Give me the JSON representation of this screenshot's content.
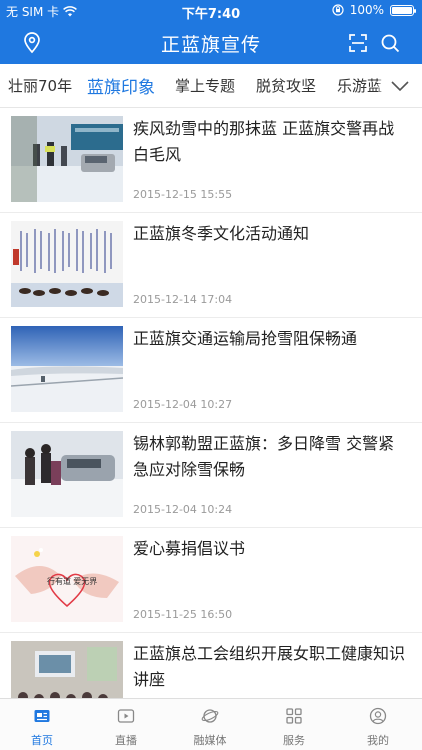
{
  "status_bar": {
    "carrier": "无 SIM 卡",
    "time": "下午7:40",
    "battery": "100%",
    "battery_level": 1.0
  },
  "header": {
    "title": "正蓝旗宣传",
    "left_icon": "location-icon",
    "right_icons": [
      "scan-icon",
      "search-icon"
    ]
  },
  "tabs": {
    "items": [
      "壮丽70年",
      "蓝旗印象",
      "掌上专题",
      "脱贫攻坚",
      "乐游蓝"
    ],
    "active_index": 1,
    "more_icon": "chevron-down-icon"
  },
  "news": [
    {
      "title": "疾风劲雪中的那抹蓝 正蓝旗交警再战白毛风",
      "time": "2015-12-15 15:55"
    },
    {
      "title": "正蓝旗冬季文化活动通知",
      "time": "2015-12-14 17:04"
    },
    {
      "title": "正蓝旗交通运输局抢雪阻保畅通",
      "time": "2015-12-04 10:27"
    },
    {
      "title": "锡林郭勒盟正蓝旗：多日降雪 交警紧急应对除雪保畅",
      "time": "2015-12-04 10:24"
    },
    {
      "title": "爱心募捐倡议书",
      "time": "2015-11-25 16:50",
      "thumb_caption": "行有道 爱无界"
    },
    {
      "title": "正蓝旗总工会组织开展女职工健康知识讲座",
      "time": ""
    }
  ],
  "bottom_nav": {
    "items": [
      {
        "label": "首页",
        "icon": "home-news-icon"
      },
      {
        "label": "直播",
        "icon": "video-play-icon"
      },
      {
        "label": "融媒体",
        "icon": "planet-icon"
      },
      {
        "label": "服务",
        "icon": "grid-icon"
      },
      {
        "label": "我的",
        "icon": "user-icon"
      }
    ],
    "active_index": 0
  },
  "colors": {
    "brand": "#1f78e0",
    "text": "#222222",
    "muted": "#9a9a9a"
  }
}
